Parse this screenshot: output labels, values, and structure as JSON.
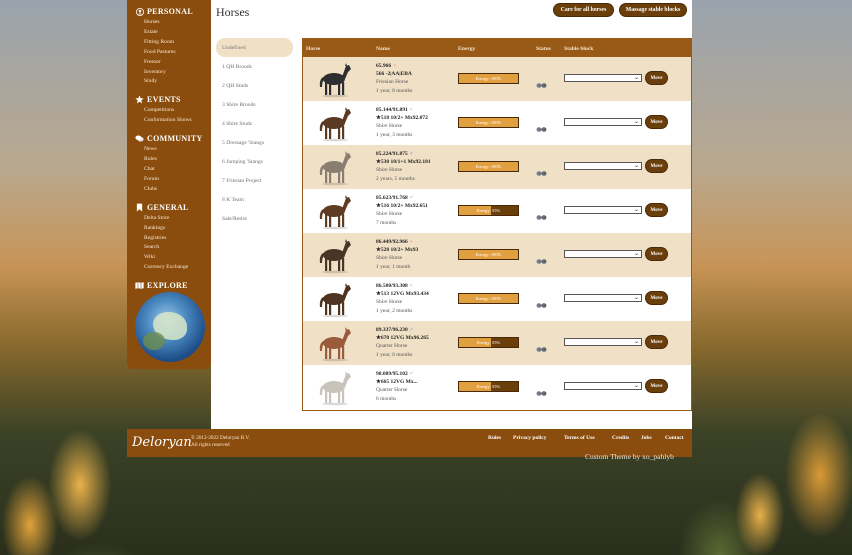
{
  "sidebar": {
    "sections": [
      {
        "title": "PERSONAL",
        "icon": "user-icon",
        "items": [
          "Horses",
          "Estate",
          "Fitting Room",
          "Food Pastures",
          "Freezer",
          "Inventory",
          "Study"
        ]
      },
      {
        "title": "EVENTS",
        "icon": "star-icon",
        "items": [
          "Competitions",
          "Conformation Shows"
        ]
      },
      {
        "title": "COMMUNITY",
        "icon": "chat-icon",
        "items": [
          "News",
          "Rules",
          "Chat",
          "Forum",
          "Clubs"
        ]
      },
      {
        "title": "GENERAL",
        "icon": "bookmark-icon",
        "items": [
          "Delta Store",
          "Rankings",
          "Registries",
          "Search",
          "Wiki",
          "Currency Exchange"
        ]
      },
      {
        "title": "EXPLORE",
        "icon": "map-icon",
        "items": []
      }
    ]
  },
  "main": {
    "title": "Horses",
    "care_all_label": "Care for all horses",
    "massage_label": "Massage stable blocks",
    "stables": [
      "Undefined",
      "1 QH Broods",
      "2 QH Studs",
      "3 Shire Broods",
      "4 Shire Studs",
      "5 Dressage 'Stangs",
      "6 Jumping 'Stangs",
      "7 Friesian Project",
      "8 K Team",
      "Sale/Retire"
    ],
    "table": {
      "headers": {
        "horse": "Horse",
        "name": "Name",
        "energy": "Energy",
        "status": "Status",
        "stable_block": "Stable block"
      },
      "move_label": "Move",
      "rows": [
        {
          "stats": "65.966",
          "sex": "female",
          "name": "566 -2|AA|EBA",
          "breed": "Friesian Horse",
          "age": "1 year, 8 months",
          "energy": 100,
          "energy_label": "Energy: 100%",
          "coat": "#2e2e30"
        },
        {
          "stats": "85.144/91.891",
          "sex": "female",
          "name": "★518 10/2+ Mx92.072",
          "breed": "Shire Horse",
          "age": "1 year, 3 months",
          "energy": 100,
          "energy_label": "Energy: 100%",
          "coat": "#5a3a22"
        },
        {
          "stats": "85.224/91.875",
          "sex": "male",
          "name": "★530 10/1+1 Mx92.181",
          "breed": "Shire Horse",
          "age": "2 years, 5 months",
          "energy": 100,
          "energy_label": "Energy: 100%",
          "coat": "#8a7e72"
        },
        {
          "stats": "85.623/91.768",
          "sex": "male",
          "name": "★516 10/2+ Mx92.651",
          "breed": "Shire Horse",
          "age": "7 months",
          "energy": 55,
          "energy_label": "Energy: 55%",
          "coat": "#5e3c24"
        },
        {
          "stats": "86.449/92.966",
          "sex": "female",
          "name": "★528 10/2+ Mx93",
          "breed": "Shire Horse",
          "age": "1 year, 1 month",
          "energy": 100,
          "energy_label": "Energy: 100%",
          "coat": "#4a3426"
        },
        {
          "stats": "86.500/93.308",
          "sex": "female",
          "name": "★513 12VG Mx93.434",
          "breed": "Shire Horse",
          "age": "1 year, 2 months",
          "energy": 100,
          "energy_label": "Energy: 100%",
          "coat": "#4e3322"
        },
        {
          "stats": "89.337/96.230",
          "sex": "male",
          "name": "★670 12VG Mx96.265",
          "breed": "Quarter Horse",
          "age": "1 year, 0 months",
          "energy": 55,
          "energy_label": "Energy: 55%",
          "coat": "#9a5a3c"
        },
        {
          "stats": "90.089/95.102",
          "sex": "male",
          "name": "★665 12VG Mx...",
          "breed": "Quarter Horse",
          "age": "6 months",
          "energy": 55,
          "energy_label": "Energy: 55%",
          "coat": "#c8c4bc"
        }
      ]
    }
  },
  "footer": {
    "logo": "Deloryan",
    "copyright_line1": "© 2012-2022 Deloryan B.V.",
    "copyright_line2": "All rights reserved",
    "links": [
      "Rules",
      "Privacy policy",
      "Terms of Use",
      "Credits",
      "Jobs",
      "Contact"
    ],
    "custom_theme": "Custom Theme by xo_pahlyb"
  },
  "colors": {
    "brown": "#8b4d0e",
    "header_brown": "#9a5a17",
    "alt_row": "#f0e0c6",
    "button": "#6b3f0c"
  }
}
